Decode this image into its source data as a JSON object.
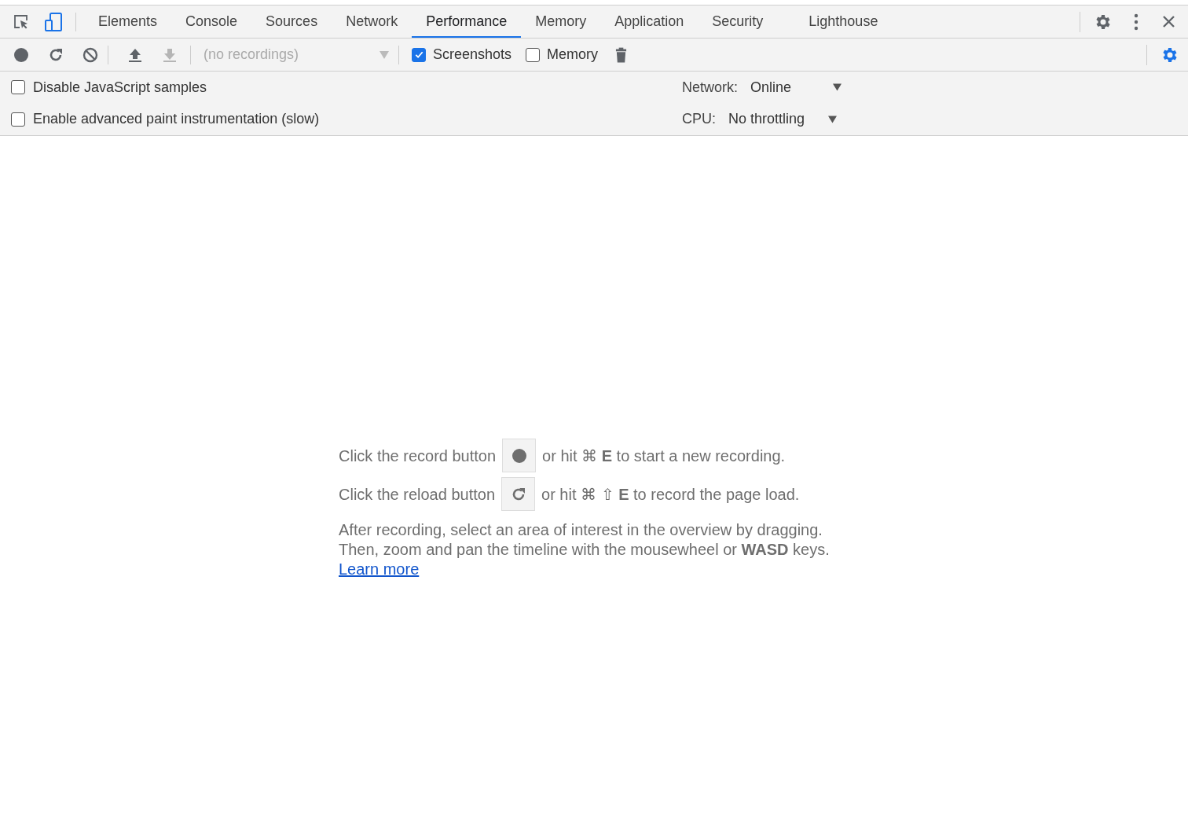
{
  "tabs": [
    {
      "label": "Elements",
      "selected": false
    },
    {
      "label": "Console",
      "selected": false
    },
    {
      "label": "Sources",
      "selected": false
    },
    {
      "label": "Network",
      "selected": false
    },
    {
      "label": "Performance",
      "selected": true
    },
    {
      "label": "Memory",
      "selected": false
    },
    {
      "label": "Application",
      "selected": false
    },
    {
      "label": "Security",
      "selected": false
    },
    {
      "label": "Lighthouse",
      "selected": false
    }
  ],
  "toolbar": {
    "buttons": [
      {
        "kind": "record",
        "disabled": false
      },
      {
        "kind": "reload",
        "disabled": false
      },
      {
        "kind": "clear",
        "disabled": false
      },
      {
        "kind": "upload",
        "disabled": false
      },
      {
        "kind": "download",
        "disabled": true
      }
    ],
    "recordings": {
      "value": "(no recordings)",
      "disabled": true
    },
    "checkboxes": [
      {
        "label": "Screenshots",
        "checked": true
      },
      {
        "label": "Memory",
        "checked": false
      }
    ]
  },
  "settings": {
    "checkboxes": [
      {
        "label": "Disable JavaScript samples",
        "checked": false
      },
      {
        "label": "Enable advanced paint instrumentation (slow)",
        "checked": false
      }
    ],
    "selects": [
      {
        "label": "Network:",
        "value": "Online"
      },
      {
        "label": "CPU:",
        "value": "No throttling"
      }
    ]
  },
  "landing": {
    "lines": [
      {
        "before": "Click the record button",
        "kind": "record",
        "after": "or hit ⌘ **E** to start a new recording."
      },
      {
        "before": "Click the reload button",
        "kind": "reload",
        "after": "or hit ⌘ ⇧ **E** to record the page load."
      }
    ],
    "paragraph": "After recording, select an area of interest in the overview by dragging. Then, zoom and pan the timeline with the mousewheel or **WASD** keys.",
    "link": "Learn more"
  }
}
